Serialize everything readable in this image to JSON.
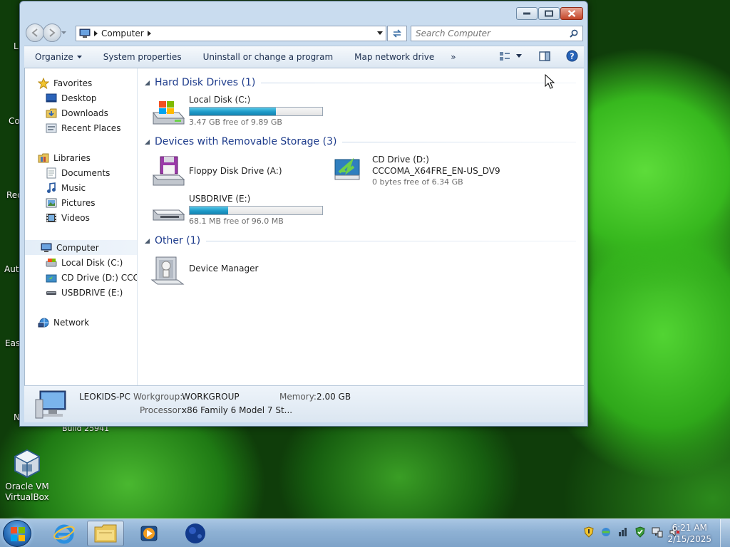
{
  "window": {
    "address_crumb": "Computer",
    "search_placeholder": "Search Computer"
  },
  "toolbar": {
    "organize": "Organize",
    "system_properties": "System properties",
    "uninstall": "Uninstall or change a program",
    "map_drive": "Map network drive",
    "more": "»"
  },
  "nav_pane": {
    "favorites": "Favorites",
    "desktop": "Desktop",
    "downloads": "Downloads",
    "recent_places": "Recent Places",
    "libraries": "Libraries",
    "documents": "Documents",
    "music": "Music",
    "pictures": "Pictures",
    "videos": "Videos",
    "computer": "Computer",
    "local_disk": "Local Disk (C:)",
    "cd_drive": "CD Drive (D:) CCCOI",
    "usbdrive": "USBDRIVE (E:)",
    "network": "Network"
  },
  "groups": {
    "hard_disk": "Hard Disk Drives (1)",
    "removable": "Devices with Removable Storage (3)",
    "other": "Other (1)"
  },
  "items": {
    "local_disk": {
      "name": "Local Disk (C:)",
      "free": "3.47 GB free of 9.89 GB",
      "used_fraction": 0.65
    },
    "floppy": {
      "name": "Floppy Disk Drive (A:)"
    },
    "cd": {
      "name": "CD Drive (D:)",
      "label": "CCCOMA_X64FRE_EN-US_DV9",
      "free": "0 bytes free of 6.34 GB"
    },
    "usb": {
      "name": "USBDRIVE (E:)",
      "free": "68.1 MB free of 96.0 MB",
      "used_fraction": 0.29
    },
    "device_manager": {
      "name": "Device Manager"
    }
  },
  "details": {
    "computer_name": "LEOKIDS-PC",
    "workgroup_label": "Workgroup:",
    "workgroup": "WORKGROUP",
    "memory_label": "Memory:",
    "memory": "2.00 GB",
    "processor_label": "Processor:",
    "processor": "x86 Family 6 Model 7 St..."
  },
  "desktop": {
    "virtualbox": "Oracle VM VirtualBox",
    "build": "Build 25941",
    "edge_l": "L",
    "edge_co": "Co",
    "edge_rec": "Rec",
    "edge_aut": "Aut",
    "edge_easy": "Easy",
    "edge_n": "N"
  },
  "taskbar": {
    "time": "6:21 AM",
    "date": "2/15/2025"
  },
  "colors": {
    "accent": "#1e3c8c",
    "bar_fill": "#1e9ac8",
    "taskbar": "#8eb1d4"
  }
}
